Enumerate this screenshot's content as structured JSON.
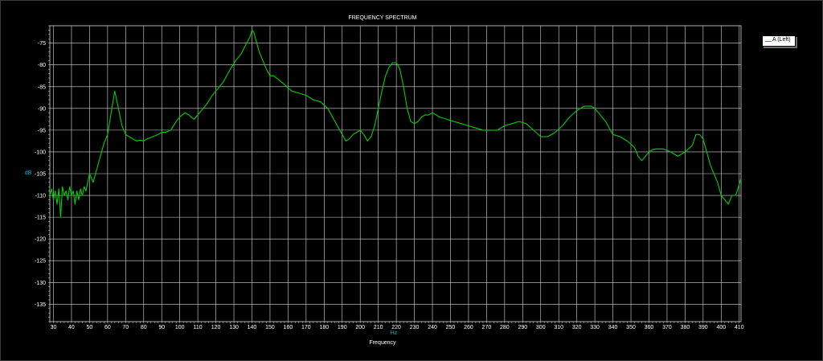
{
  "chart_data": {
    "type": "line",
    "title": "FREQUENCY SPECTRUM",
    "xlabel": "Frequency",
    "xunit": "Hz",
    "yunit": "dB",
    "xlim": [
      28,
      411
    ],
    "ylim": [
      -139,
      -71
    ],
    "x_ticks": [
      30,
      40,
      50,
      60,
      70,
      80,
      90,
      100,
      110,
      120,
      130,
      140,
      150,
      160,
      170,
      180,
      190,
      200,
      210,
      220,
      230,
      240,
      250,
      260,
      270,
      280,
      290,
      300,
      310,
      320,
      330,
      340,
      350,
      360,
      370,
      380,
      390,
      400,
      410
    ],
    "y_ticks": [
      -75,
      -80,
      -85,
      -90,
      -95,
      -100,
      -105,
      -110,
      -115,
      -120,
      -125,
      -130,
      -135
    ],
    "grid": true,
    "legend_position": "top-right",
    "colors": {
      "background": "#000000",
      "grid": "#d8d8d8",
      "series": "#00d000",
      "unit": "#00b7c7"
    },
    "series": [
      {
        "name": "A (Left)",
        "x": [
          28,
          29,
          30,
          31,
          32,
          33,
          34,
          35,
          36,
          37,
          38,
          39,
          40,
          41,
          42,
          43,
          44,
          45,
          46,
          47,
          48,
          49,
          50,
          52,
          54,
          56,
          58,
          60,
          62,
          64,
          66,
          68,
          70,
          72,
          74,
          76,
          78,
          80,
          82,
          85,
          88,
          90,
          92,
          95,
          98,
          100,
          103,
          105,
          108,
          110,
          112,
          115,
          118,
          120,
          124,
          128,
          131,
          134,
          137,
          139,
          140,
          141,
          142,
          144,
          146,
          148,
          150,
          152,
          155,
          158,
          162,
          166,
          170,
          174,
          178,
          182,
          186,
          190,
          192,
          194,
          196,
          198,
          200,
          202,
          204,
          206,
          208,
          210,
          212,
          214,
          216,
          218,
          220,
          222,
          224,
          226,
          228,
          230,
          232,
          234,
          236,
          238,
          240,
          242,
          244,
          248,
          252,
          256,
          260,
          264,
          268,
          272,
          276,
          280,
          284,
          288,
          292,
          296,
          300,
          304,
          308,
          312,
          316,
          320,
          324,
          328,
          330,
          332,
          336,
          340,
          344,
          348,
          352,
          354,
          356,
          358,
          360,
          362,
          364,
          368,
          372,
          376,
          380,
          384,
          386,
          388,
          390,
          392,
          394,
          396,
          398,
          400,
          402,
          404,
          406,
          408,
          410,
          411
        ],
        "y": [
          -110,
          -108.5,
          -111,
          -109,
          -112,
          -108.5,
          -115,
          -108,
          -110,
          -109,
          -111,
          -108,
          -110,
          -109,
          -112,
          -109,
          -111,
          -108.5,
          -110,
          -108,
          -109,
          -107,
          -105,
          -107,
          -104,
          -101,
          -98,
          -96,
          -91,
          -86,
          -90,
          -94,
          -96,
          -96.5,
          -97,
          -97.5,
          -97.3,
          -97.5,
          -97,
          -96.5,
          -96,
          -95.5,
          -95.5,
          -95,
          -93,
          -92,
          -91,
          -91.5,
          -92.5,
          -91.5,
          -90.5,
          -89,
          -87,
          -86,
          -84,
          -81,
          -79,
          -77.5,
          -75,
          -73.5,
          -72,
          -72.5,
          -74,
          -77,
          -79,
          -81,
          -82.5,
          -82.5,
          -83.5,
          -84.5,
          -86,
          -86.5,
          -87,
          -88,
          -88.5,
          -90,
          -93,
          -96,
          -97.5,
          -97,
          -96,
          -95.5,
          -95,
          -96,
          -97.5,
          -96.5,
          -94,
          -90,
          -86,
          -82.5,
          -80.5,
          -79.5,
          -79.5,
          -81,
          -85,
          -90,
          -93,
          -93.5,
          -93,
          -92,
          -91.5,
          -91.5,
          -91,
          -91.5,
          -92,
          -92.5,
          -93,
          -93.5,
          -94,
          -94.5,
          -95,
          -95,
          -95,
          -94,
          -93.5,
          -93,
          -93.5,
          -95,
          -96.5,
          -96.5,
          -95.5,
          -94,
          -92,
          -90.5,
          -89.5,
          -89.5,
          -90,
          -91,
          -93,
          -96,
          -96.5,
          -97.5,
          -99,
          -101,
          -102,
          -101,
          -100,
          -99.5,
          -99.3,
          -99.3,
          -100,
          -101,
          -100,
          -98.5,
          -96,
          -96,
          -97,
          -100,
          -103,
          -105,
          -107,
          -110,
          -111,
          -112,
          -110,
          -110,
          -107.5,
          -106
        ]
      }
    ]
  },
  "legend": {
    "label": "A (Left)"
  }
}
